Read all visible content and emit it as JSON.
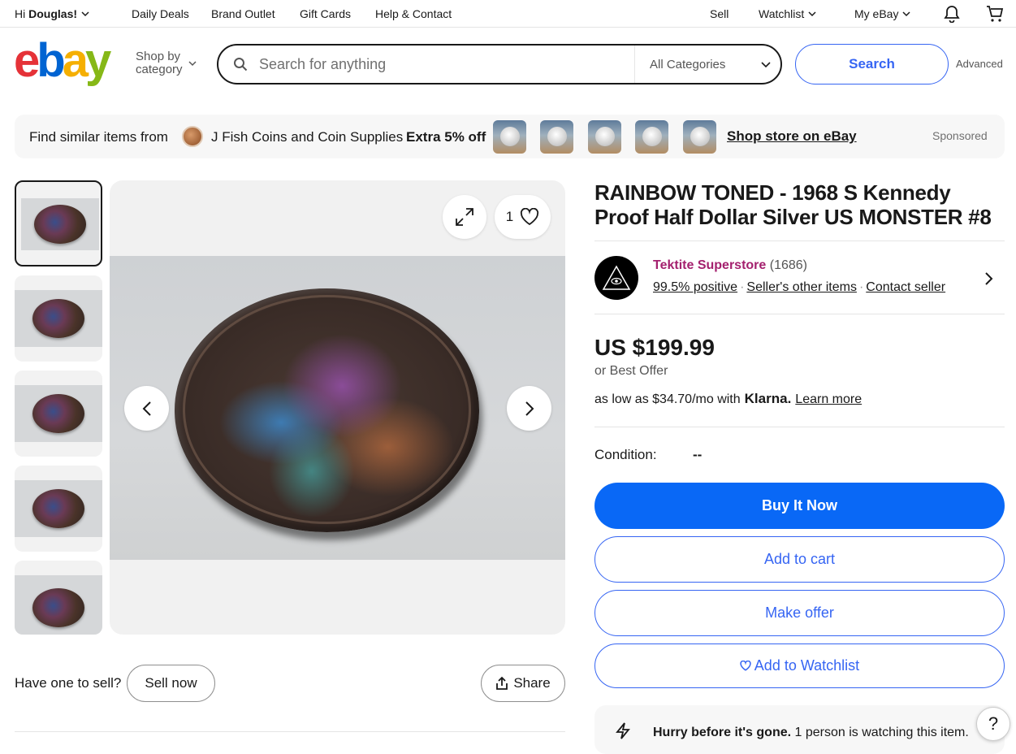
{
  "topnav": {
    "greeting_prefix": "Hi ",
    "user_name": "Douglas!",
    "links": [
      "Daily Deals",
      "Brand Outlet",
      "Gift Cards",
      "Help & Contact"
    ],
    "sell": "Sell",
    "watchlist": "Watchlist",
    "my_ebay": "My eBay"
  },
  "header": {
    "logo_letters": [
      "e",
      "b",
      "a",
      "y"
    ],
    "logo_colors": [
      "#e53238",
      "#0064d2",
      "#f5af02",
      "#86b817"
    ],
    "shop_by_line1": "Shop by",
    "shop_by_line2": "category",
    "search_placeholder": "Search for anything",
    "category_selected": "All Categories",
    "search_button": "Search",
    "advanced": "Advanced"
  },
  "banner": {
    "prefix": "Find similar items from",
    "store_name": "J Fish Coins and Coin Supplies",
    "discount": "Extra 5% off",
    "shop_store": "Shop store on eBay",
    "sponsored": "Sponsored",
    "thumb_count": 5
  },
  "gallery": {
    "watch_count": "1",
    "have_one": "Have one to sell?",
    "sell_now": "Sell now",
    "share": "Share"
  },
  "item": {
    "title": "RAINBOW TONED - 1968 S Kennedy Proof Half Dollar Silver US MONSTER #8",
    "seller_name": "Tektite Superstore",
    "seller_count": "(1686)",
    "feedback": "99.5% positive",
    "other_items": "Seller's other items",
    "contact": "Contact seller",
    "price": "US $199.99",
    "best_offer": "or Best Offer",
    "klarna_prefix": "as low as $34.70/mo with",
    "klarna_brand": "Klarna.",
    "learn_more": "Learn more",
    "condition_label": "Condition:",
    "condition_value": "--",
    "buy_now": "Buy It Now",
    "add_cart": "Add to cart",
    "make_offer": "Make offer",
    "add_watchlist": "Add to Watchlist",
    "hurry_bold": "Hurry before it's gone.",
    "hurry_text": " 1 person is watching this item."
  },
  "help": "?"
}
